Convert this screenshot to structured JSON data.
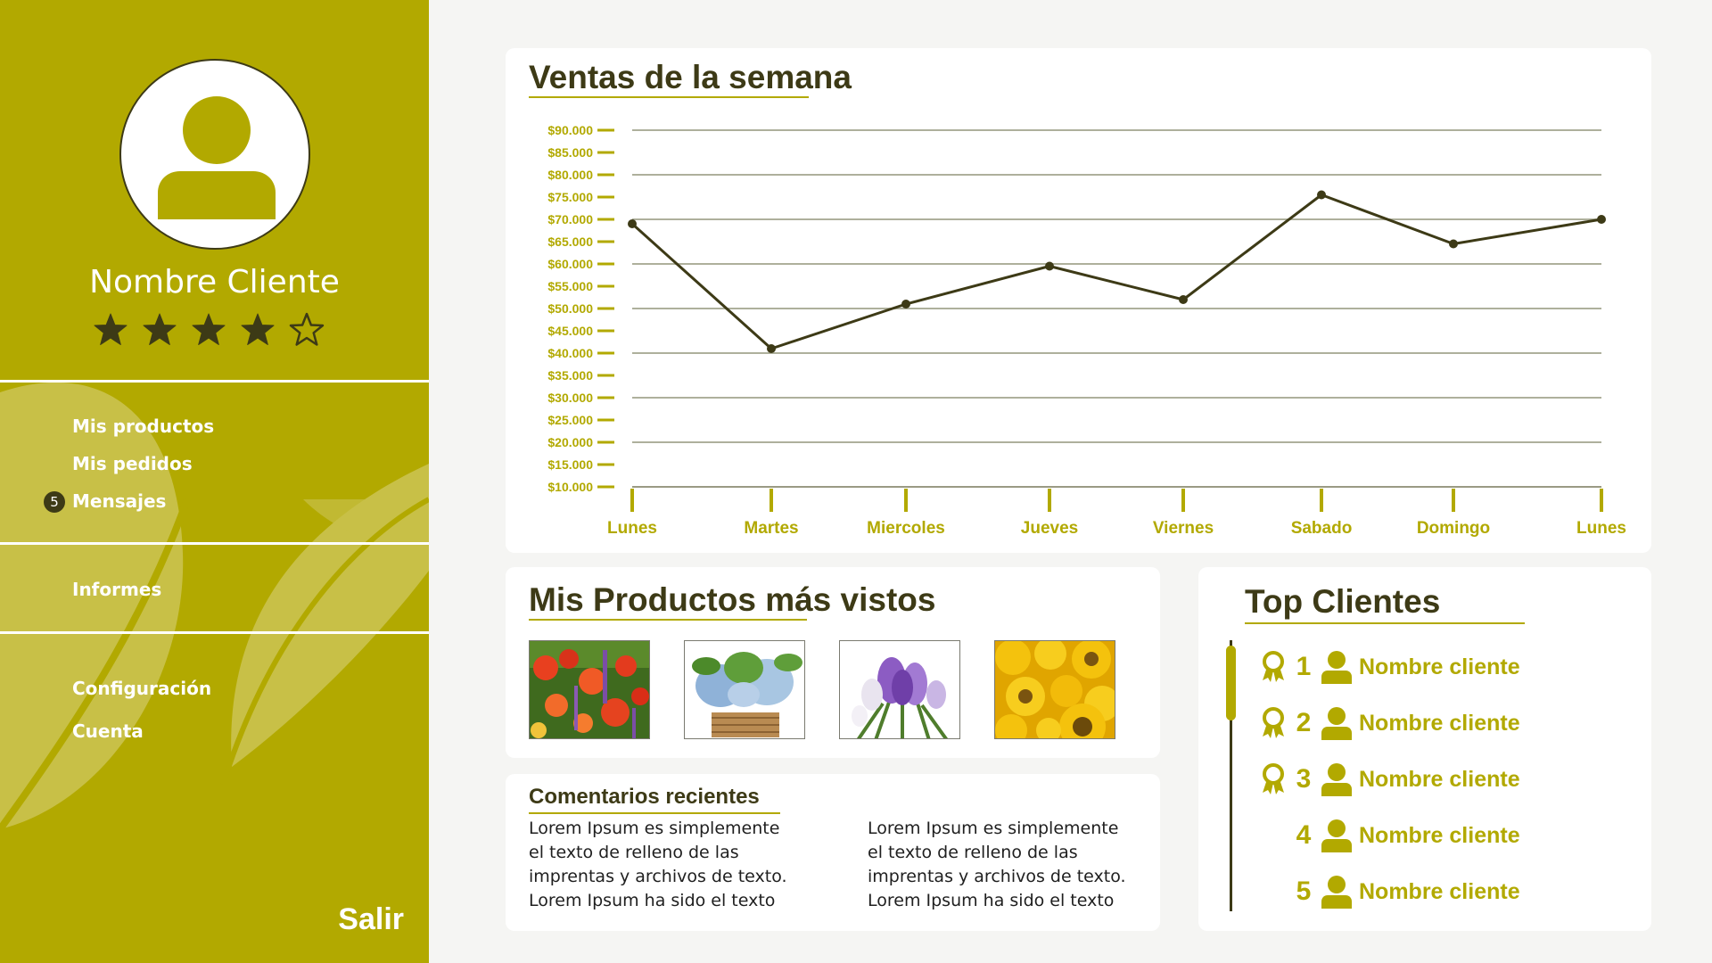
{
  "profile": {
    "name": "Nombre Cliente",
    "rating": 4,
    "max_rating": 5
  },
  "nav": {
    "products": "Mis productos",
    "orders": "Mis pedidos",
    "messages": "Mensajes",
    "messages_count": "5",
    "reports": "Informes",
    "settings": "Configuración",
    "account": "Cuenta",
    "logout": "Salir"
  },
  "sales": {
    "title": "Ventas de la semana"
  },
  "chart_data": {
    "type": "line",
    "categories": [
      "Lunes",
      "Martes",
      "Miercoles",
      "Jueves",
      "Viernes",
      "Sabado",
      "Domingo",
      "Lunes"
    ],
    "values": [
      69000,
      41000,
      51000,
      59500,
      52000,
      75500,
      64500,
      70000
    ],
    "ylim": [
      10000,
      90000
    ],
    "ytick_step": 5000,
    "yticks": [
      "$10.000",
      "$15.000",
      "$20.000",
      "$25.000",
      "$30.000",
      "$35.000",
      "$40.000",
      "$45.000",
      "$50.000",
      "$55.000",
      "$60.000",
      "$65.000",
      "$70.000",
      "$75.000",
      "$80.000",
      "$85.000",
      "$90.000"
    ],
    "grid": "horizontal, every 10.000",
    "line_color": "#3d3a16",
    "tick_color": "#b2a900"
  },
  "products": {
    "title": "Mis Productos más vistos",
    "images": [
      "red-poppies-image",
      "hydrangea-basket-image",
      "crocus-image",
      "sunflowers-image"
    ]
  },
  "comments": {
    "title": "Comentarios recientes",
    "items": [
      "Lorem Ipsum es simplemente el texto de relleno de las imprentas y archivos de texto. Lorem Ipsum ha sido el texto",
      "Lorem Ipsum es simplemente el texto de relleno de las imprentas y archivos de texto. Lorem Ipsum ha sido el texto"
    ]
  },
  "top_clients": {
    "title": "Top Clientes",
    "items": [
      {
        "rank": "1",
        "name": "Nombre cliente",
        "award": true
      },
      {
        "rank": "2",
        "name": "Nombre cliente",
        "award": true
      },
      {
        "rank": "3",
        "name": "Nombre cliente",
        "award": true
      },
      {
        "rank": "4",
        "name": "Nombre cliente",
        "award": false
      },
      {
        "rank": "5",
        "name": "Nombre cliente",
        "award": false
      }
    ]
  },
  "colors": {
    "accent": "#b2a900",
    "dark": "#3d3a16",
    "background": "#f5f5f3"
  }
}
